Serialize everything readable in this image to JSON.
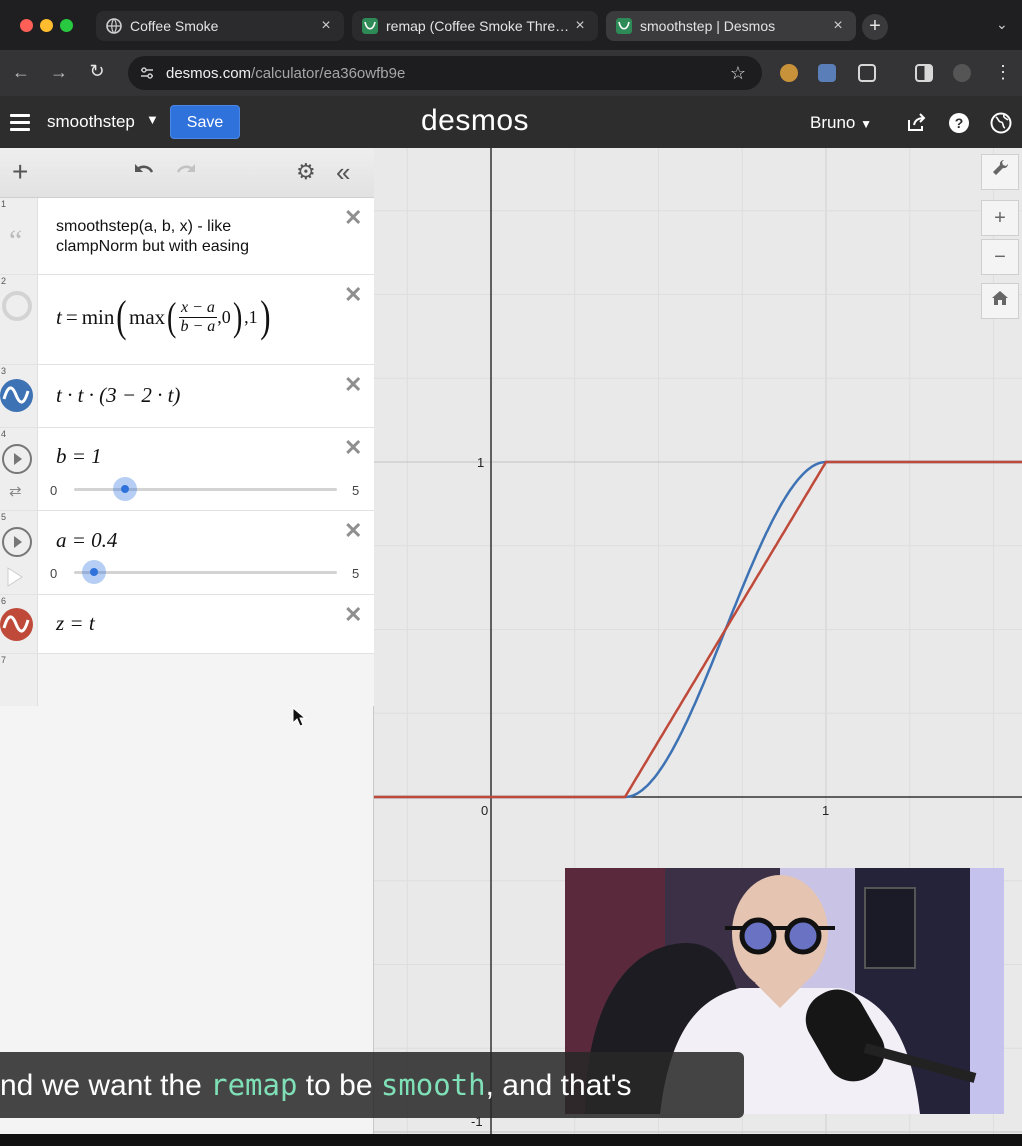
{
  "browser": {
    "tabs": [
      {
        "title": "Coffee Smoke",
        "close": "×"
      },
      {
        "title": "remap (Coffee Smoke Three.js",
        "close": "×"
      },
      {
        "title": "smoothstep | Desmos",
        "close": "×"
      }
    ],
    "new_tab": "+",
    "tab_menu": "⌄",
    "url_host": "desmos.com",
    "url_path": "/calculator/ea36owfb9e"
  },
  "desmos": {
    "graph_title": "smoothstep",
    "save_label": "Save",
    "logo": "desmos",
    "user": "Bruno"
  },
  "expressions": [
    {
      "num": "1",
      "text": "smoothstep(a, b, x) - like clampNorm but with easing"
    },
    {
      "num": "2",
      "frac_num": "x − a",
      "frac_den": "b − a"
    },
    {
      "num": "3",
      "latex": "t · t · (3 − 2 · t)"
    },
    {
      "num": "4",
      "latex": "b = 1",
      "slider_min": "0",
      "slider_max": "5",
      "value": 1
    },
    {
      "num": "5",
      "latex": "a = 0.4",
      "slider_min": "0",
      "slider_max": "5",
      "value": 0.4
    },
    {
      "num": "6",
      "latex": "z = t"
    },
    {
      "num": "7"
    }
  ],
  "graph": {
    "x_ticks": [
      "0",
      "1"
    ],
    "y_ticks": [
      "1",
      "-1"
    ],
    "curve_colors": {
      "smoothstep": "#3d72b4",
      "linear": "#c04a3a"
    },
    "a": 0.4,
    "b": 1
  },
  "caption": {
    "part1": "nd we want the ",
    "code1": "remap",
    "part2": " to be ",
    "code2": "smooth",
    "part3": ", and that's"
  },
  "colors": {
    "accent": "#2f72dc",
    "header": "#2d2d2d"
  }
}
